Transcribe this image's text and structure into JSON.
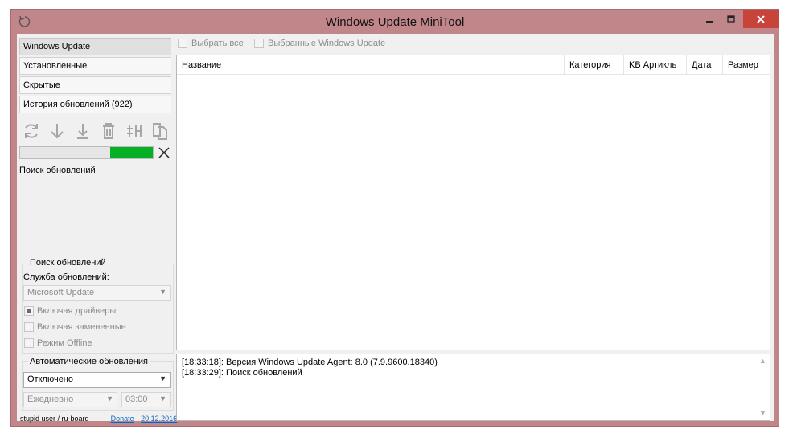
{
  "window": {
    "title": "Windows Update MiniTool",
    "app_icon": "refresh-app-icon",
    "controls": [
      "minimize-icon",
      "maximize-icon",
      "close-icon"
    ]
  },
  "sidebar": {
    "nav": [
      {
        "label": "Windows Update",
        "active": true
      },
      {
        "label": "Установленные",
        "active": false
      },
      {
        "label": "Скрытые",
        "active": false
      },
      {
        "label": "История обновлений (922)",
        "active": false
      }
    ],
    "toolbar_icons": [
      "refresh-icon",
      "download-icon",
      "install-icon",
      "delete-icon",
      "hide-icon",
      "copy-icon"
    ],
    "progress": {
      "fraction": 0.32,
      "color": "#06b025"
    },
    "status": "Поиск обновлений",
    "search_group": {
      "title": "Поиск обновлений",
      "service_label": "Служба обновлений:",
      "service_value": "Microsoft Update",
      "checks": [
        {
          "label": "Включая драйверы",
          "checked": true
        },
        {
          "label": "Включая замененные",
          "checked": false
        },
        {
          "label": "Режим Offline",
          "checked": false
        }
      ]
    },
    "auto_group": {
      "title": "Автоматические обновления",
      "mode_value": "Отключено",
      "frequency_value": "Ежедневно",
      "time_value": "03:00"
    },
    "footer": {
      "credit": "stupid user / ru-board",
      "donate": "Donate",
      "date": "20.12.2016"
    }
  },
  "main": {
    "select_all": "Выбрать все",
    "selected_updates": "Выбранные Windows Update",
    "columns": [
      "Название",
      "Категория",
      "KB Артикль",
      "Дата",
      "Размер"
    ]
  },
  "log": {
    "lines": [
      "[18:33:18]: Версия Windows Update Agent: 8.0 (7.9.9600.18340)",
      "[18:33:29]: Поиск обновлений"
    ]
  },
  "colors": {
    "frame": "#c1868a",
    "close_button": "#c7443a",
    "progress": "#06b025"
  }
}
